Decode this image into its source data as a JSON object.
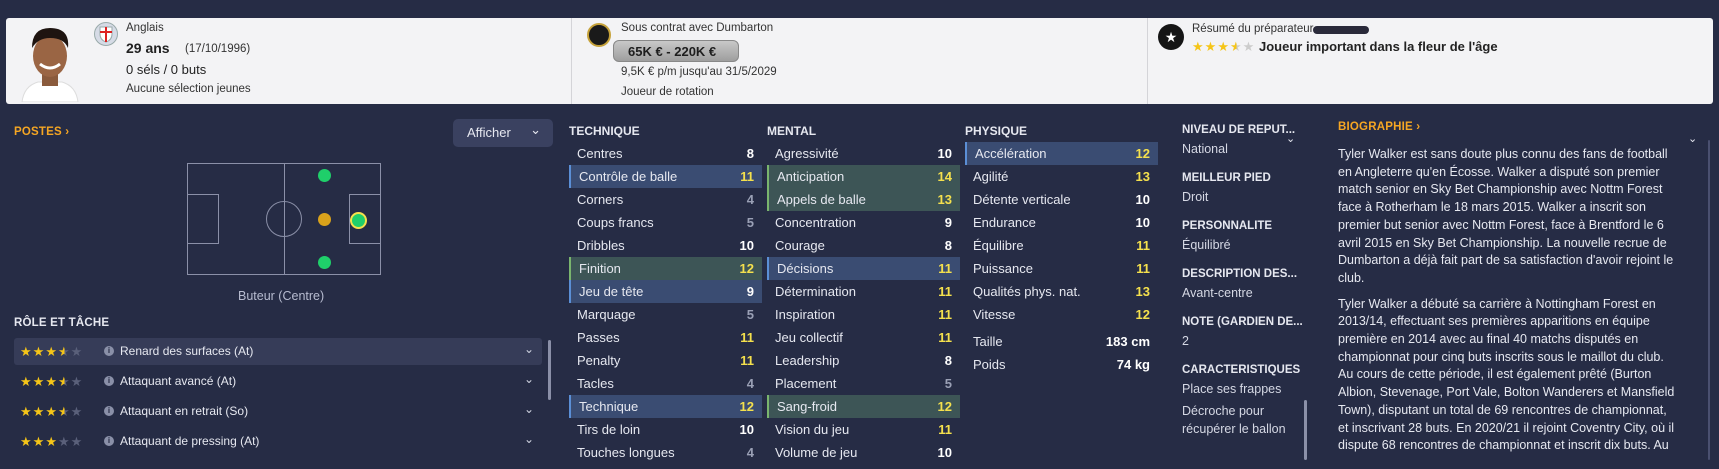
{
  "header": {
    "nationality": "Anglais",
    "age": "29 ans",
    "dob": "(17/10/1996)",
    "caps": "0 séls / 0 buts",
    "youth": "Aucune sélection jeunes",
    "contract_label": "Sous contrat avec Dumbarton",
    "value": "65K € - 220K €",
    "wage": "9,5K € p/m jusqu'au 31/5/2029",
    "squad_status": "Joueur de rotation",
    "coach_report_label": "Résumé du préparateur",
    "coach_summary": "Joueur important dans la fleur de l'âge",
    "coach_stars": 3.5
  },
  "positions": {
    "title": "POSTES",
    "title_chevron": "›",
    "show_button": "Afficher",
    "show_chevron": "⌄",
    "position_label": "Buteur (Centre)"
  },
  "roles": {
    "title": "RÔLE ET TÂCHE",
    "items": [
      {
        "label": "Renard des surfaces (At)",
        "stars": 3.5
      },
      {
        "label": "Attaquant avancé (At)",
        "stars": 3.5
      },
      {
        "label": "Attaquant en retrait (So)",
        "stars": 3.5
      },
      {
        "label": "Attaquant de pressing (At)",
        "stars": 3
      }
    ]
  },
  "technique": {
    "title": "TECHNIQUE",
    "items": [
      {
        "name": "Centres",
        "value": "8",
        "hl": "",
        "color": "white"
      },
      {
        "name": "Contrôle de balle",
        "value": "11",
        "hl": "b",
        "color": "yellow"
      },
      {
        "name": "Corners",
        "value": "4",
        "hl": "",
        "color": "grey"
      },
      {
        "name": "Coups francs",
        "value": "5",
        "hl": "",
        "color": "grey"
      },
      {
        "name": "Dribbles",
        "value": "10",
        "hl": "",
        "color": "white"
      },
      {
        "name": "Finition",
        "value": "12",
        "hl": "g",
        "color": "yellow"
      },
      {
        "name": "Jeu de tête",
        "value": "9",
        "hl": "b",
        "color": "white"
      },
      {
        "name": "Marquage",
        "value": "5",
        "hl": "",
        "color": "grey"
      },
      {
        "name": "Passes",
        "value": "11",
        "hl": "",
        "color": "yellow"
      },
      {
        "name": "Penalty",
        "value": "11",
        "hl": "",
        "color": "yellow"
      },
      {
        "name": "Tacles",
        "value": "4",
        "hl": "",
        "color": "grey"
      },
      {
        "name": "Technique",
        "value": "12",
        "hl": "b",
        "color": "yellow"
      },
      {
        "name": "Tirs de loin",
        "value": "10",
        "hl": "",
        "color": "white"
      },
      {
        "name": "Touches longues",
        "value": "4",
        "hl": "",
        "color": "grey"
      }
    ]
  },
  "mental": {
    "title": "MENTAL",
    "items": [
      {
        "name": "Agressivité",
        "value": "10",
        "hl": "",
        "color": "white"
      },
      {
        "name": "Anticipation",
        "value": "14",
        "hl": "g",
        "color": "yellow"
      },
      {
        "name": "Appels de balle",
        "value": "13",
        "hl": "g",
        "color": "yellow"
      },
      {
        "name": "Concentration",
        "value": "9",
        "hl": "",
        "color": "white"
      },
      {
        "name": "Courage",
        "value": "8",
        "hl": "",
        "color": "white"
      },
      {
        "name": "Décisions",
        "value": "11",
        "hl": "b",
        "color": "yellow"
      },
      {
        "name": "Détermination",
        "value": "11",
        "hl": "",
        "color": "yellow"
      },
      {
        "name": "Inspiration",
        "value": "11",
        "hl": "",
        "color": "yellow"
      },
      {
        "name": "Jeu collectif",
        "value": "11",
        "hl": "",
        "color": "yellow"
      },
      {
        "name": "Leadership",
        "value": "8",
        "hl": "",
        "color": "white"
      },
      {
        "name": "Placement",
        "value": "5",
        "hl": "",
        "color": "grey"
      },
      {
        "name": "Sang-froid",
        "value": "12",
        "hl": "g",
        "color": "yellow"
      },
      {
        "name": "Vision du jeu",
        "value": "11",
        "hl": "",
        "color": "yellow"
      },
      {
        "name": "Volume de jeu",
        "value": "10",
        "hl": "",
        "color": "white"
      }
    ]
  },
  "physique": {
    "title": "PHYSIQUE",
    "items": [
      {
        "name": "Accélération",
        "value": "12",
        "hl": "b",
        "color": "yellow"
      },
      {
        "name": "Agilité",
        "value": "13",
        "hl": "",
        "color": "yellow"
      },
      {
        "name": "Détente verticale",
        "value": "10",
        "hl": "",
        "color": "white"
      },
      {
        "name": "Endurance",
        "value": "10",
        "hl": "",
        "color": "white"
      },
      {
        "name": "Équilibre",
        "value": "11",
        "hl": "",
        "color": "yellow"
      },
      {
        "name": "Puissance",
        "value": "11",
        "hl": "",
        "color": "yellow"
      },
      {
        "name": "Qualités phys. nat.",
        "value": "13",
        "hl": "",
        "color": "yellow"
      },
      {
        "name": "Vitesse",
        "value": "12",
        "hl": "",
        "color": "yellow"
      }
    ],
    "height_label": "Taille",
    "height": "183 cm",
    "weight_label": "Poids",
    "weight": "74 kg"
  },
  "info": [
    {
      "label": "NIVEAU DE RÉPUT...",
      "value": "National"
    },
    {
      "label": "MEILLEUR PIED",
      "value": "Droit"
    },
    {
      "label": "PERSONNALITÉ",
      "value": "Équilibré"
    },
    {
      "label": "DESCRIPTION DES...",
      "value": "Avant-centre"
    },
    {
      "label": "NOTE (GARDIEN DE...",
      "value": "2"
    },
    {
      "label": "CARACTÉRISTIQUES",
      "value": "Place ses frappes"
    },
    {
      "label": "",
      "value": "Décroche pour récupérer le ballon"
    }
  ],
  "bio": {
    "title": "BIOGRAPHIE",
    "title_chevron": "›",
    "p1": "Tyler Walker est sans doute plus connu des fans de football en Angleterre qu'en Écosse. Walker a disputé son premier match senior en Sky Bet Championship avec Nottm Forest face à Rotherham le 18 mars 2015. Walker a inscrit son premier but senior avec Nottm Forest, face à Brentford le 6 avril 2015 en Sky Bet Championship. La nouvelle recrue de Dumbarton a déjà fait part de sa satisfaction d'avoir rejoint le club.",
    "p2": "Tyler Walker a débuté sa carrière à Nottingham Forest en 2013/14, effectuant ses premières apparitions en équipe première en 2014 avec au final 40 matchs disputés en championnat pour cinq buts inscrits sous le maillot du club. Au cours de cette période, il est également prêté (Burton Albion, Stevenage, Port Vale, Bolton Wanderers et Mansfield Town), disputant un total de 69 rencontres de championnat, et inscrivant 28 buts. En 2020/21 il rejoint Coventry City, où il dispute 68 rencontres de championnat et inscrit dix buts. Au"
  },
  "colors": {
    "accent": "#f5a623",
    "highlight_blue": "#3a4c72",
    "highlight_green": "#3d5556",
    "background": "#262c45"
  }
}
